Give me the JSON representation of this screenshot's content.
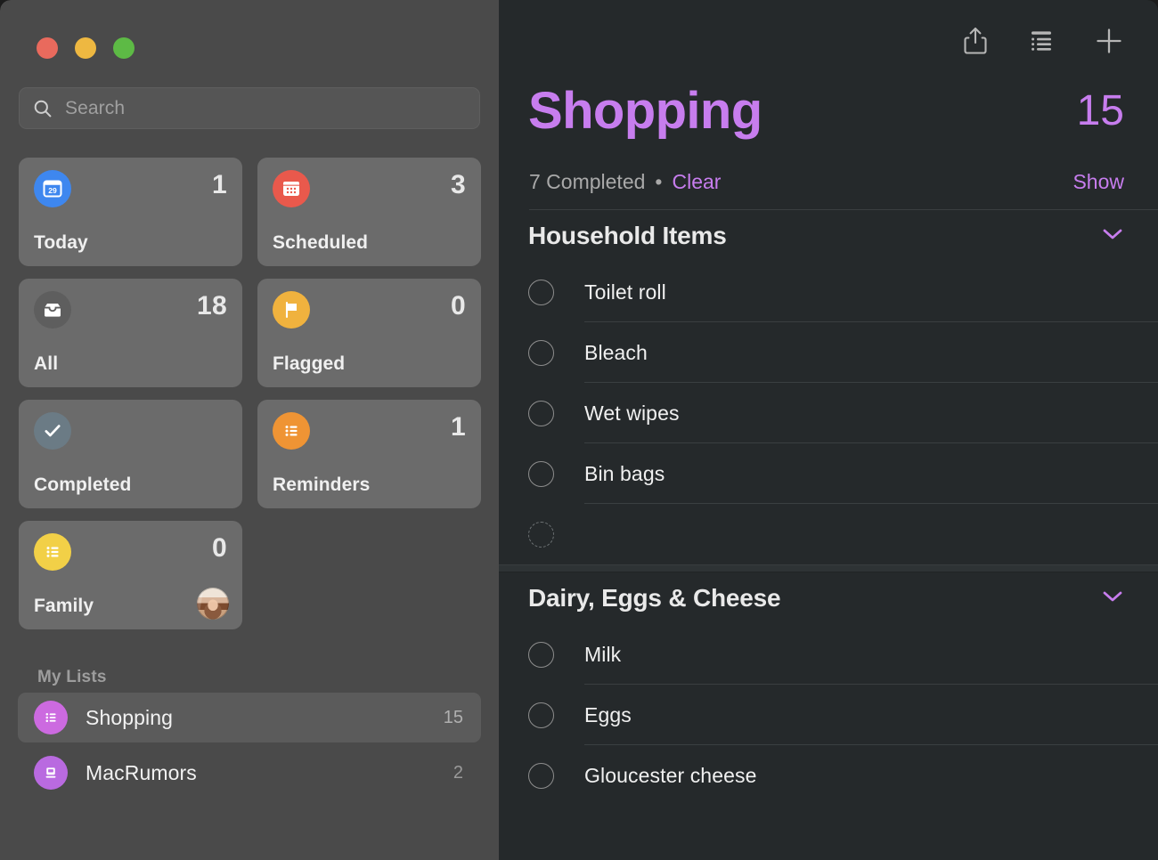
{
  "window": {
    "traffic_lights": [
      "close",
      "minimize",
      "zoom"
    ],
    "colors": {
      "sidebar_bg": "#4a4a4a",
      "main_bg": "#25292b",
      "card_bg": "#6b6b6b",
      "accent_purple": "#c77dee",
      "divider": "#3a3f41"
    }
  },
  "sidebar": {
    "search": {
      "placeholder": "Search",
      "value": "",
      "icon": "search-icon"
    },
    "smart_cards": [
      {
        "label": "Today",
        "count": "1",
        "icon": "calendar-day-icon",
        "icon_badge": "29",
        "color": "#3e87ef"
      },
      {
        "label": "Scheduled",
        "count": "3",
        "icon": "calendar-icon",
        "color": "#e9594c"
      },
      {
        "label": "All",
        "count": "18",
        "icon": "inbox-tray-icon",
        "color": "#5e5e5e"
      },
      {
        "label": "Flagged",
        "count": "0",
        "icon": "flag-icon",
        "color": "#f0b23e"
      },
      {
        "label": "Completed",
        "count": "",
        "icon": "checkmark-icon",
        "color": "#6b7b85"
      },
      {
        "label": "Reminders",
        "count": "1",
        "icon": "list-bullet-icon",
        "color": "#ef9434"
      },
      {
        "label": "Family",
        "count": "0",
        "icon": "list-bullet-icon",
        "color": "#f2d047",
        "avatar": "shared-member-avatar"
      }
    ],
    "my_lists_header": "My Lists",
    "lists": [
      {
        "name": "Shopping",
        "count": "15",
        "icon": "list-bullet-icon",
        "color": "#cc6ae0",
        "selected": true
      },
      {
        "name": "MacRumors",
        "count": "2",
        "icon": "computer-icon",
        "color": "#b96ae0",
        "selected": false
      }
    ]
  },
  "main": {
    "toolbar": [
      {
        "name": "share-icon",
        "label": "Share"
      },
      {
        "name": "list-group-icon",
        "label": "View options"
      },
      {
        "name": "plus-icon",
        "label": "Add reminder"
      }
    ],
    "title": "Shopping",
    "total_count": "15",
    "completed_text": "7 Completed",
    "separator_dot": "•",
    "clear_label": "Clear",
    "show_label": "Show",
    "sections": [
      {
        "title": "Household Items",
        "collapse_icon": "chevron-down-icon",
        "items": [
          {
            "text": "Toilet roll",
            "completed": false
          },
          {
            "text": "Bleach",
            "completed": false
          },
          {
            "text": "Wet wipes",
            "completed": false
          },
          {
            "text": "Bin bags",
            "completed": false
          }
        ],
        "new_item_row": {
          "text": "",
          "placeholder": ""
        }
      },
      {
        "title": "Dairy, Eggs & Cheese",
        "collapse_icon": "chevron-down-icon",
        "items": [
          {
            "text": "Milk",
            "completed": false
          },
          {
            "text": "Eggs",
            "completed": false
          },
          {
            "text": "Gloucester cheese",
            "completed": false
          }
        ]
      }
    ]
  }
}
